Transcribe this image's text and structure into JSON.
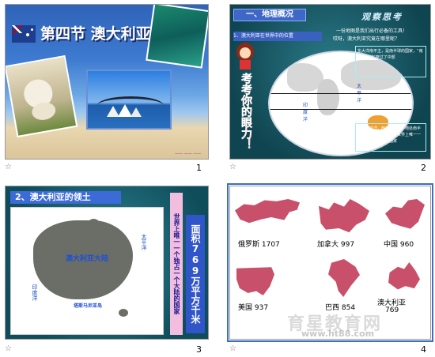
{
  "slides": [
    {
      "number": "1",
      "title": "第四节 澳大利亚",
      "small_caption": "—— —— ——"
    },
    {
      "number": "2",
      "section_title": "一、地理概况",
      "header_right": "观察思考",
      "question1": "1、澳大利亚在世界中的位置",
      "question_tip": "一份地图是我们出行必备的工具！",
      "question_tip2": "哎呀，澳大利亚究竟在哪里呢？",
      "vertical_slogan": "考考你的眼力！",
      "map_labels": {
        "pacific": "太平洋",
        "indian": "印度洋"
      },
      "note_top": "东大洋南平主，是南半球的国家，“南北回归线”穿过了中部",
      "note_bottom": "东临太平洋，西临印度洋，地处南半球，大陆四周环海，是世界上唯一一个独占一个大陆的国家"
    },
    {
      "number": "3",
      "section_title": "2、澳大利亚的领土",
      "continent_label": "澳大利亚大陆",
      "ocean_right": "太平洋",
      "ocean_left": "印度洋",
      "island_label": "塔斯马尼亚岛",
      "vertical_area": "面积769万平方千米",
      "vertical_note": "世界上唯一一个独占一个大陆的国家"
    },
    {
      "number": "4",
      "countries": [
        {
          "label": "俄罗斯 1707"
        },
        {
          "label": "加拿大 997"
        },
        {
          "label": "中国 960"
        },
        {
          "label": "美国 937"
        },
        {
          "label": "巴西 854"
        },
        {
          "label": "澳大利亚",
          "value": "769"
        }
      ],
      "watermark": "育星教育网",
      "watermark_url": "www.ht88.com"
    }
  ],
  "slide_icon": "slide-transition-icon",
  "colors": {
    "map_red": "#c8506a",
    "ocean_teal": "#1d5f6e",
    "title_white": "#ffffff"
  }
}
